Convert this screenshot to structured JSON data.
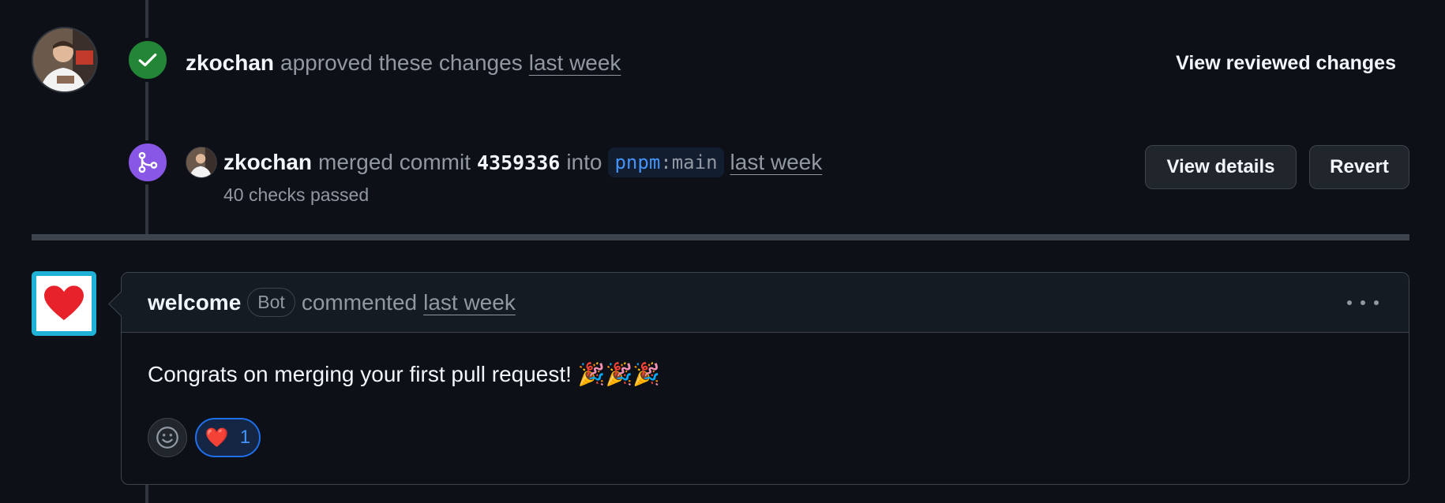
{
  "approval": {
    "author": "zkochan",
    "action": "approved these changes",
    "time": "last week",
    "view_reviewed_label": "View reviewed changes"
  },
  "merge": {
    "author": "zkochan",
    "action": "merged commit",
    "sha": "4359336",
    "into": "into",
    "repo": "pnpm",
    "sep": ":",
    "branch": "main",
    "time": "last week",
    "checks": "40 checks passed",
    "view_details_label": "View details",
    "revert_label": "Revert"
  },
  "comment": {
    "author": "welcome",
    "bot_badge": "Bot",
    "action": "commented",
    "time": "last week",
    "body": "Congrats on merging your first pull request! 🎉🎉🎉",
    "reactions": [
      {
        "icon": "heart-icon",
        "emoji": "❤️",
        "count": "1",
        "selected": true
      }
    ]
  },
  "colors": {
    "approved": "#238636",
    "merged": "#8957e5",
    "accent": "#4493f8",
    "background": "#0d1117"
  }
}
